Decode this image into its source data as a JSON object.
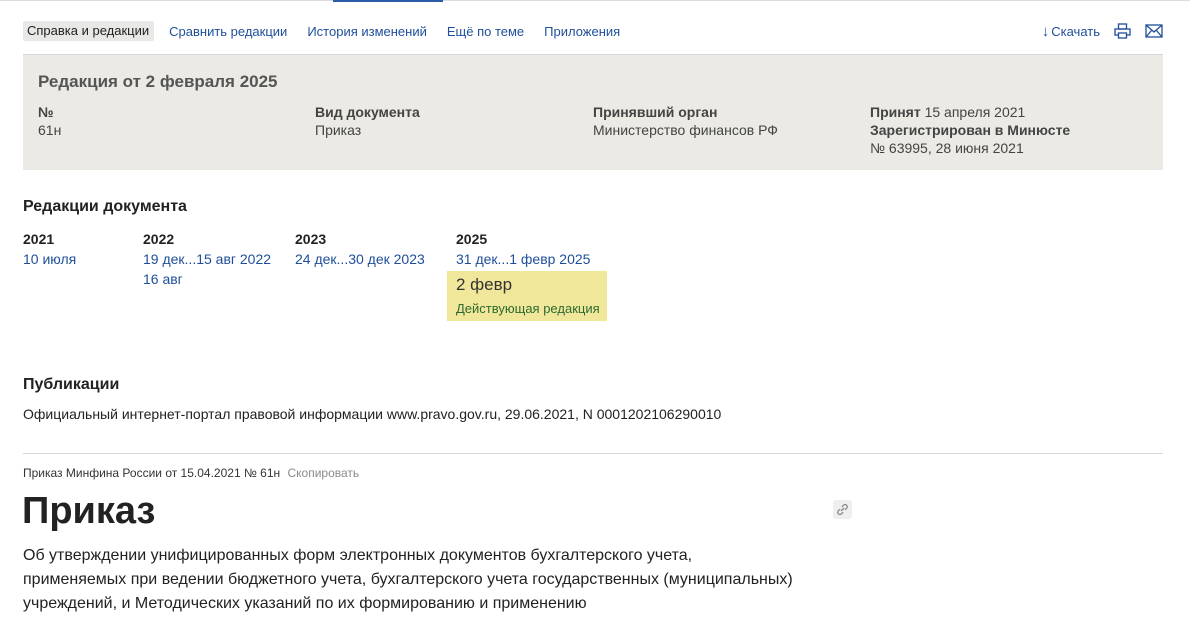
{
  "nav": {
    "tabs": [
      {
        "label": "Справка и редакции"
      },
      {
        "label": "Сравнить редакции"
      },
      {
        "label": "История изменений"
      },
      {
        "label": "Ещё по теме"
      },
      {
        "label": "Приложения"
      }
    ],
    "download_label": "Скачать",
    "icons": [
      "download-arrow-icon",
      "print-icon",
      "mail-icon"
    ]
  },
  "info": {
    "title": "Редакция от 2 февраля 2025",
    "number_label": "№",
    "number_value": "61н",
    "doc_type_label": "Вид документа",
    "doc_type_value": "Приказ",
    "authority_label": "Принявший орган",
    "authority_value": "Министерство финансов РФ",
    "adopted_label": "Принят",
    "adopted_value": "15 апреля 2021",
    "registered_label": "Зарегистрирован в Минюсте",
    "registered_value": "№ 63995, 28 июня 2021"
  },
  "revisions": {
    "heading": "Редакции документа",
    "years": [
      {
        "year": "2021",
        "links": [
          "10 июля"
        ]
      },
      {
        "year": "2022",
        "links": [
          "19 дек...15 авг 2022",
          "16 авг"
        ]
      },
      {
        "year": "2023",
        "links": [
          "24 дек...30 дек 2023"
        ]
      },
      {
        "year": "2025",
        "links": [
          "31 дек...1 февр 2025"
        ]
      }
    ],
    "current_date": "2 февр",
    "current_status": "Действующая редакция"
  },
  "publications": {
    "heading": "Публикации",
    "text": "Официальный интернет-портал правовой информации www.pravo.gov.ru, 29.06.2021, N 0001202106290010"
  },
  "document": {
    "citation": "Приказ Минфина России от 15.04.2021 № 61н",
    "copy_label": "Скопировать",
    "title": "Приказ",
    "description": "Об утверждении унифицированных форм электронных документов бухгалтерского учета, применяемых при ведении бюджетного учета, бухгалтерского учета государственных (муниципальных) учреждений, и Методических указаний по их формированию и применению"
  },
  "colors": {
    "link": "#1f4f9a",
    "panel_bg": "#ebeae4",
    "current_bg": "#f1e79b",
    "status_green": "#2d6a2f"
  }
}
